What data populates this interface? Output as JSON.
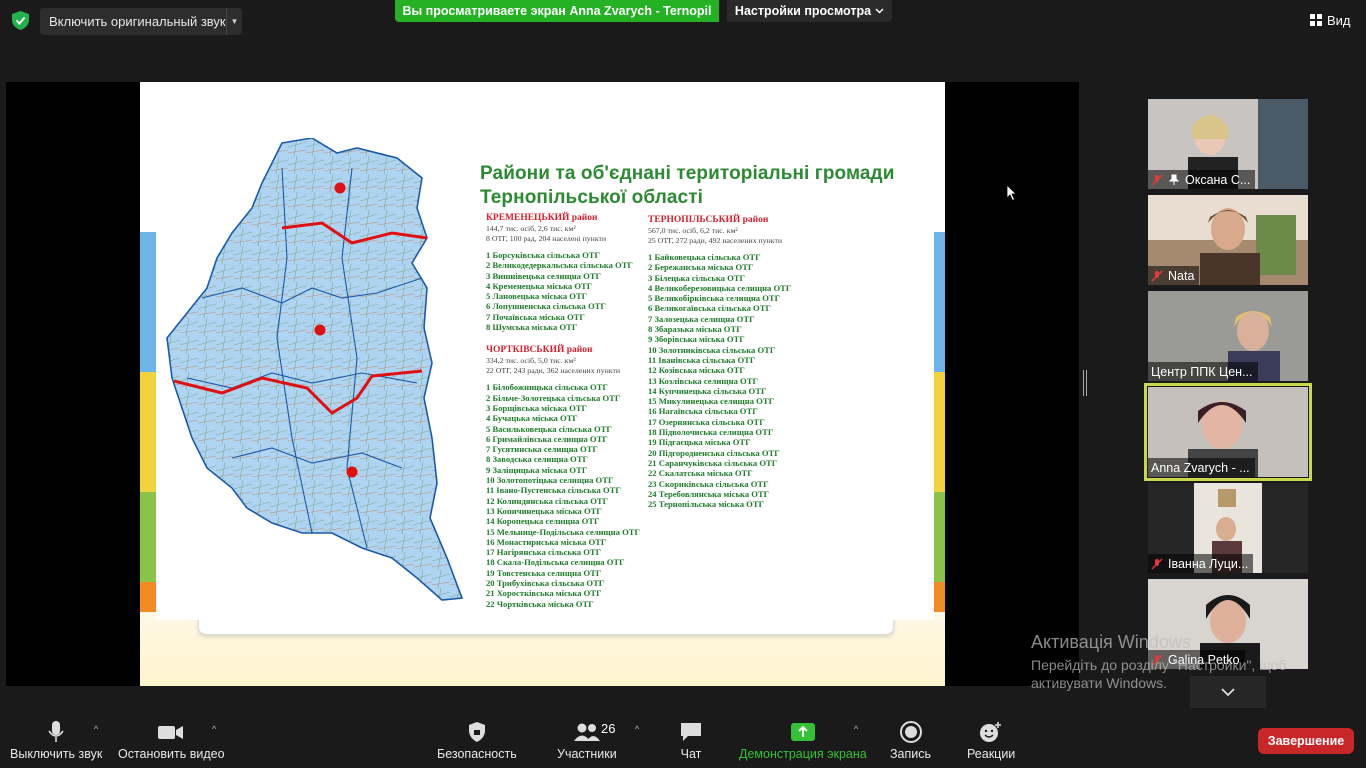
{
  "topbar": {
    "audio_button": "Включить оригинальный звук",
    "share_banner": "Вы просматриваете экран Anna Zvarych - Ternopil",
    "view_settings": "Настройки просмотра",
    "view_label": "Вид"
  },
  "slide": {
    "title_line1": "Райони та об'єднані територіальні громади",
    "title_line2": "Тернопільської області",
    "kremenets": {
      "name": "КРЕМЕНЕЦЬКИЙ район",
      "stats1": "144,7 тис. осіб, 2,6 тис. км²",
      "stats2": "8 ОТГ, 100 рад, 204 населені пункти",
      "items": [
        "1  Борсуківська сільська ОТГ",
        "2  Великодедеркальська сільська ОТГ",
        "3  Вишнівецька селищна ОТГ",
        "4  Кременецька міська ОТГ",
        "5  Лановецька міська ОТГ",
        "6  Лопушненська сільська ОТГ",
        "7  Почаївська міська ОТГ",
        "8  Шумська міська ОТГ"
      ]
    },
    "chortkiv": {
      "name": "ЧОРТКІВСЬКИЙ район",
      "stats1": "334,2 тис. осіб, 5,0 тис. км²",
      "stats2": "22 ОТГ, 243 ради, 362 населених пункти",
      "items": [
        "1  Білобожницька сільська ОТГ",
        "2  Більче-Золотецька сільська ОТГ",
        "3  Борщівська міська ОТГ",
        "4  Бучацька міська ОТГ",
        "5  Васильковецька сільська ОТГ",
        "6 Гримайлівська селищна ОТГ",
        "7 Гусятинська селищна ОТГ",
        "8 Заводська селищна ОТГ",
        "9 Заліщицька міська ОТГ",
        "10 Золотопотіцька селищна ОТГ",
        "11 Івано-Пустенська сільська ОТГ",
        "12 Колиндянська сільська ОТГ",
        "13 Копичинецька міська ОТГ",
        "14 Коропецька селищна ОТГ",
        "15 Мельнице-Подільська селищна ОТГ",
        "16 Монастириська міська ОТГ",
        "17 Нагірянська сільська ОТГ",
        "18 Скала-Подільська селищна ОТГ",
        "19 Товстенська селищна ОТГ",
        "20 Трибухівська сільська ОТГ",
        "21 Хоростківська міська ОТГ",
        "22 Чортківська міська ОТГ"
      ]
    },
    "ternopil": {
      "name": "ТЕРНОПІЛЬСЬКИЙ район",
      "stats1": "567,0 тис. осіб, 6,2 тис. км²",
      "stats2": "25 ОТГ, 272 ради, 492 населених пункти",
      "items": [
        "1  Байковецька сільська ОТГ",
        "2  Бережанська міська ОТГ",
        "3  Білецька сільська ОТГ",
        "4  Великоберезовицька селищна ОТГ",
        "5 Великобірківська селищна ОТГ",
        "6 Великогаївська сільська ОТГ",
        "7  Залозецька селищна ОТГ",
        "8  Збаразька міська ОТГ",
        "9  Зборівська міська ОТГ",
        "10 Золотниківська сільська ОТГ",
        "11 Іванівська сільська ОТГ",
        "12 Козівська міська ОТГ",
        "13 Козлівська селищна ОТГ",
        "14 Купчинецька сільська ОТГ",
        "15 Микулинецька селищна ОТГ",
        "16 Наraївська сільська ОТГ",
        "17 Озернянська сільська ОТГ",
        "18 Підволочиська селищна ОТГ",
        "19 Підгаєцька міська ОТГ",
        "20 Підгородненська сільська ОТГ",
        "21 Саранчуківська сільська ОТГ",
        "22 Скалатська міська ОТГ",
        "23 Скориківська сільська ОТГ",
        "24 Теребовлянська міська ОТГ",
        "25 Тернопільська міська ОТГ"
      ]
    }
  },
  "participants": [
    {
      "name": "Оксана С...",
      "muted": true,
      "pinned": true
    },
    {
      "name": "Nata",
      "muted": true
    },
    {
      "name": "Центр ППК Цен...",
      "muted": false
    },
    {
      "name": "Anna Zvarych - ...",
      "muted": false,
      "active": true
    },
    {
      "name": "Іванна Луци...",
      "muted": true
    },
    {
      "name": "Galina Petko",
      "muted": true
    }
  ],
  "watermark": {
    "line1": "Активація Windows",
    "line2": "Перейдіть до розділу \"Настройки\", щоб",
    "line3": "активувати Windows."
  },
  "toolbar": {
    "mute": "Выключить звук",
    "video": "Остановить видео",
    "security": "Безопасность",
    "participants": "Участники",
    "participants_count": "26",
    "chat": "Чат",
    "share": "Демонстрация экрана",
    "record": "Запись",
    "reactions": "Реакции",
    "end": "Завершение"
  },
  "colors": {
    "share_green": "#24b224",
    "active_outline": "#c9d84a",
    "end_red": "#c9262a",
    "slide_title_green": "#2c8a32",
    "district_red": "#d4202f"
  }
}
